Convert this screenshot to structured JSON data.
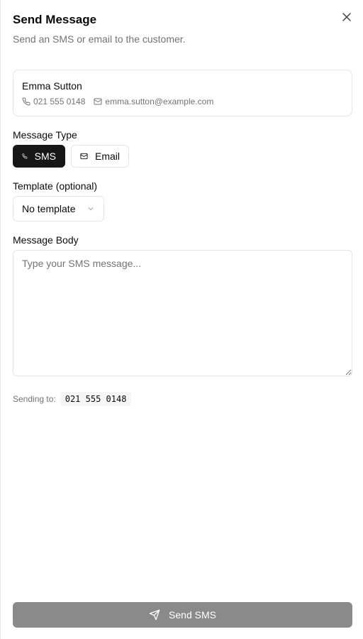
{
  "dialog": {
    "title": "Send Message",
    "subtitle": "Send an SMS or email to the customer."
  },
  "customer": {
    "name": "Emma Sutton",
    "phone": "021 555 0148",
    "email": "emma.sutton@example.com"
  },
  "message_type": {
    "label": "Message Type",
    "options": [
      {
        "label": "SMS",
        "icon": "phone-icon",
        "selected": true
      },
      {
        "label": "Email",
        "icon": "mail-icon",
        "selected": false
      }
    ]
  },
  "template": {
    "label": "Template (optional)",
    "selected": "No template"
  },
  "body": {
    "label": "Message Body",
    "placeholder": "Type your SMS message...",
    "value": ""
  },
  "sending": {
    "label": "Sending to:",
    "value": "021 555 0148"
  },
  "send_button": {
    "label": "Send SMS",
    "icon": "send-icon"
  },
  "colors": {
    "primary": "#171717",
    "disabled_button": "#8a8a8a",
    "muted_text": "#737373",
    "border": "#e5e5e5"
  }
}
